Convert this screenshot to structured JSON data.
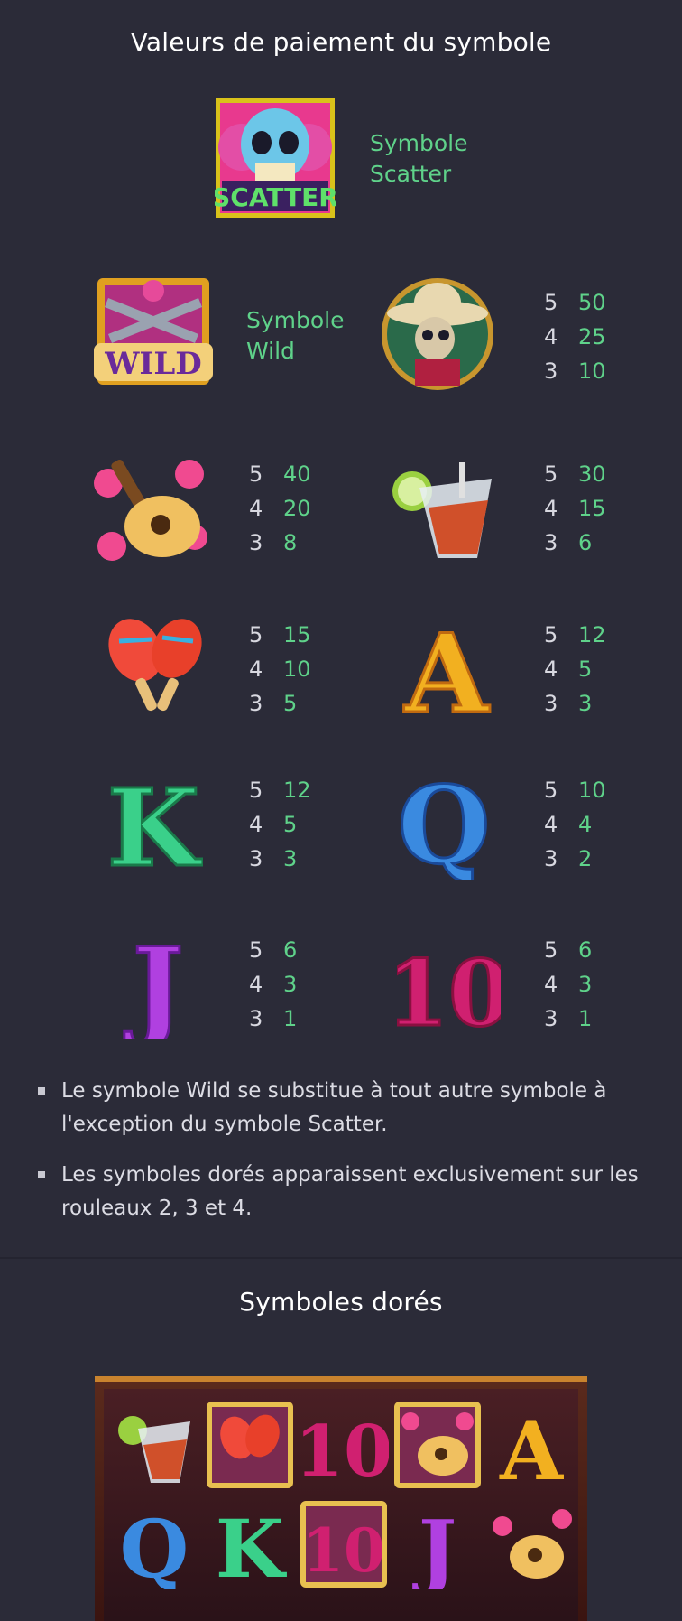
{
  "header": {
    "title": "Valeurs de paiement du symbole"
  },
  "scatter": {
    "label_line1": "Symbole",
    "label_line2": "Scatter"
  },
  "wild": {
    "label_line1": "Symbole",
    "label_line2": "Wild"
  },
  "paytable": {
    "mariachi": [
      [
        "5",
        "50"
      ],
      [
        "4",
        "25"
      ],
      [
        "3",
        "10"
      ]
    ],
    "guitar": [
      [
        "5",
        "40"
      ],
      [
        "4",
        "20"
      ],
      [
        "3",
        "8"
      ]
    ],
    "drink": [
      [
        "5",
        "30"
      ],
      [
        "4",
        "15"
      ],
      [
        "3",
        "6"
      ]
    ],
    "maracas": [
      [
        "5",
        "15"
      ],
      [
        "4",
        "10"
      ],
      [
        "3",
        "5"
      ]
    ],
    "A": [
      [
        "5",
        "12"
      ],
      [
        "4",
        "5"
      ],
      [
        "3",
        "3"
      ]
    ],
    "K": [
      [
        "5",
        "12"
      ],
      [
        "4",
        "5"
      ],
      [
        "3",
        "3"
      ]
    ],
    "Q": [
      [
        "5",
        "10"
      ],
      [
        "4",
        "4"
      ],
      [
        "3",
        "2"
      ]
    ],
    "J": [
      [
        "5",
        "6"
      ],
      [
        "4",
        "3"
      ],
      [
        "3",
        "1"
      ]
    ],
    "10": [
      [
        "5",
        "6"
      ],
      [
        "4",
        "3"
      ],
      [
        "3",
        "1"
      ]
    ]
  },
  "notes": [
    "Le symbole Wild se substitue à tout autre symbole à l'exception du symbole Scatter.",
    "Les symboles dorés apparaissent exclusivement sur les rouleaux 2, 3 et 4."
  ],
  "golden": {
    "title": "Symboles dorés"
  },
  "icons": {
    "scatter": "scatter-skull-icon",
    "wild": "wild-pistols-icon",
    "mariachi": "mariachi-skeleton-icon",
    "guitar": "guitar-roses-icon",
    "drink": "tequila-drink-icon",
    "maracas": "maracas-icon",
    "A": "letter-a-icon",
    "K": "letter-k-icon",
    "Q": "letter-q-icon",
    "J": "letter-j-icon",
    "10": "number-ten-icon"
  },
  "colors": {
    "background": "#2b2b38",
    "accent_green": "#5fd28a"
  },
  "reels": {
    "row1": [
      "drink",
      "maracas",
      "10",
      "guitar",
      "A"
    ],
    "row2": [
      "Q",
      "K",
      "10",
      "J",
      "guitar"
    ]
  }
}
